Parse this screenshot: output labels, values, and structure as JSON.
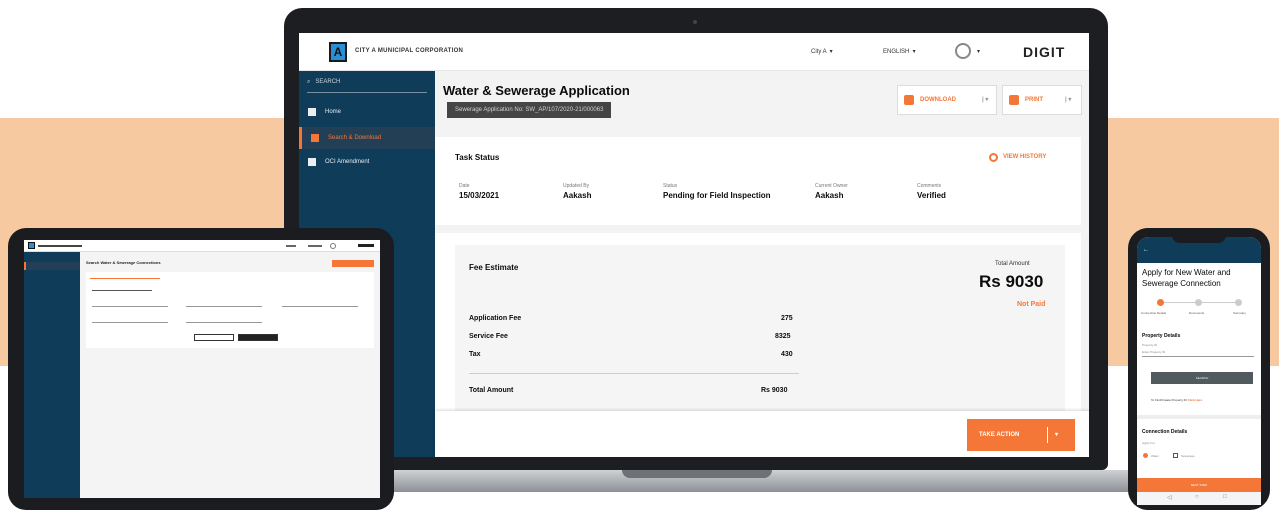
{
  "laptop": {
    "org_name": "CITY A MUNICIPAL CORPORATION",
    "city": "City A",
    "language": "ENGLISH",
    "brand": "DIGIT",
    "logo_letter": "A",
    "sidebar": {
      "search_placeholder": "SEARCH",
      "items": [
        {
          "label": "Home",
          "icon": "home-icon"
        },
        {
          "label": "Search & Download",
          "icon": "search-doc-icon"
        },
        {
          "label": "OCI Amendment",
          "icon": "document-icon"
        }
      ]
    },
    "page_title": "Water & Sewerage Application",
    "application_no": "Sewerage Application No: SW_AP/107/2020-21/000063",
    "download_label": "DOWNLOAD",
    "print_label": "PRINT",
    "task_status": {
      "title": "Task Status",
      "view_history": "VIEW HISTORY",
      "fields": [
        {
          "label": "Date",
          "value": "15/03/2021"
        },
        {
          "label": "Updated By",
          "value": "Aakash"
        },
        {
          "label": "Status",
          "value": "Pending for Field Inspection"
        },
        {
          "label": "Current Owner",
          "value": "Aakash"
        },
        {
          "label": "Comments",
          "value": "Verified"
        }
      ]
    },
    "fee": {
      "title": "Fee Estimate",
      "total_label": "Total Amount",
      "total_value": "Rs 9030",
      "status": "Not Paid",
      "rows": [
        {
          "label": "Application Fee",
          "value": "275"
        },
        {
          "label": "Service Fee",
          "value": "8325"
        },
        {
          "label": "Tax",
          "value": "430"
        }
      ],
      "total_row_label": "Total Amount",
      "total_row_value": "Rs 9030"
    },
    "take_action": "TAKE ACTION"
  },
  "tablet": {
    "title": "Search Water & Sewerage Connections"
  },
  "phone": {
    "title": "Apply for New Water and Sewerage Connection",
    "steps": [
      "Connection Details",
      "Documents",
      "Summary"
    ],
    "property_section": "Property Details",
    "property_id_label": "Property ID",
    "property_id_placeholder": "Enter Property ID",
    "search_button": "SEARCH",
    "find_link_prefix": "To Find/Create Property ID",
    "find_link_action": "Click Here",
    "connection_section": "Connection Details",
    "apply_for_label": "Apply For",
    "option_water": "Water",
    "option_sewerage": "Sewerage",
    "next_button": "NEXT STEP"
  },
  "colors": {
    "accent": "#f47738",
    "sidebar": "#0e3c59",
    "band": "#f6c9a0"
  }
}
